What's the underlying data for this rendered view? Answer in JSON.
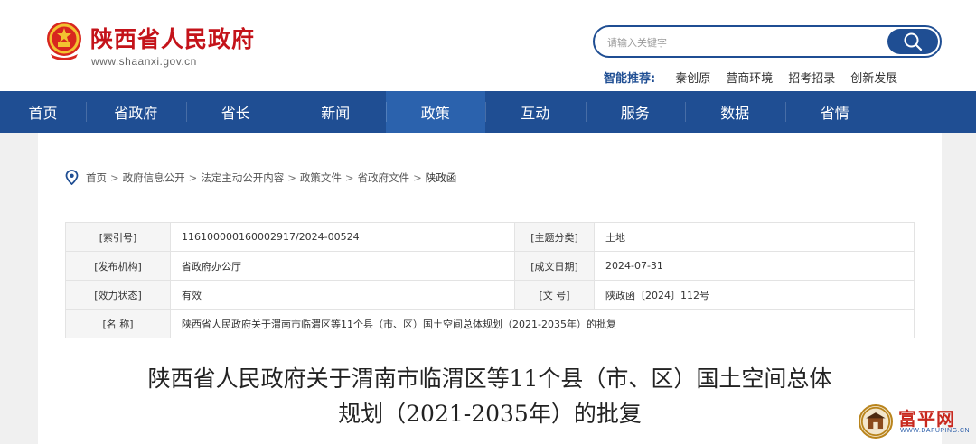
{
  "header": {
    "site_name": "陕西省人民政府",
    "site_domain": "www.shaanxi.gov.cn"
  },
  "search": {
    "placeholder": "请输入关键字"
  },
  "hot": {
    "label": "智能推荐:",
    "items": [
      "秦创原",
      "营商环境",
      "招考招录",
      "创新发展"
    ]
  },
  "nav": {
    "items": [
      "首页",
      "省政府",
      "省长",
      "新闻",
      "政策",
      "互动",
      "服务",
      "数据",
      "省情"
    ],
    "active": "政策"
  },
  "breadcrumb": {
    "items": [
      "首页",
      "政府信息公开",
      "法定主动公开内容",
      "政策文件",
      "省政府文件"
    ],
    "separator": ">",
    "current": "陕政函"
  },
  "meta": {
    "index_label": "[索引号]",
    "index_value": "116100000160002917/2024-00524",
    "topic_label": "[主题分类]",
    "topic_value": "土地",
    "publisher_label": "[发布机构]",
    "publisher_value": "省政府办公厅",
    "date_label": "[成文日期]",
    "date_value": "2024-07-31",
    "status_label": "[效力状态]",
    "status_value": "有效",
    "docno_label": "[文      号]",
    "docno_value": "陕政函〔2024〕112号",
    "name_label": "[名      称]",
    "name_value": "陕西省人民政府关于渭南市临渭区等11个县（市、区）国土空间总体规划（2021-2035年）的批复"
  },
  "article": {
    "title_line1": "陕西省人民政府关于渭南市临渭区等11个县（市、区）国土空间总体",
    "title_line2": "规划（2021-2035年）的批复"
  },
  "watermark": {
    "text": "富平网",
    "domain": "WWW.DAFUPING.CN"
  },
  "colors": {
    "brand_red": "#c4131a",
    "nav_blue": "#1f4e93",
    "nav_active": "#2b62ad"
  }
}
